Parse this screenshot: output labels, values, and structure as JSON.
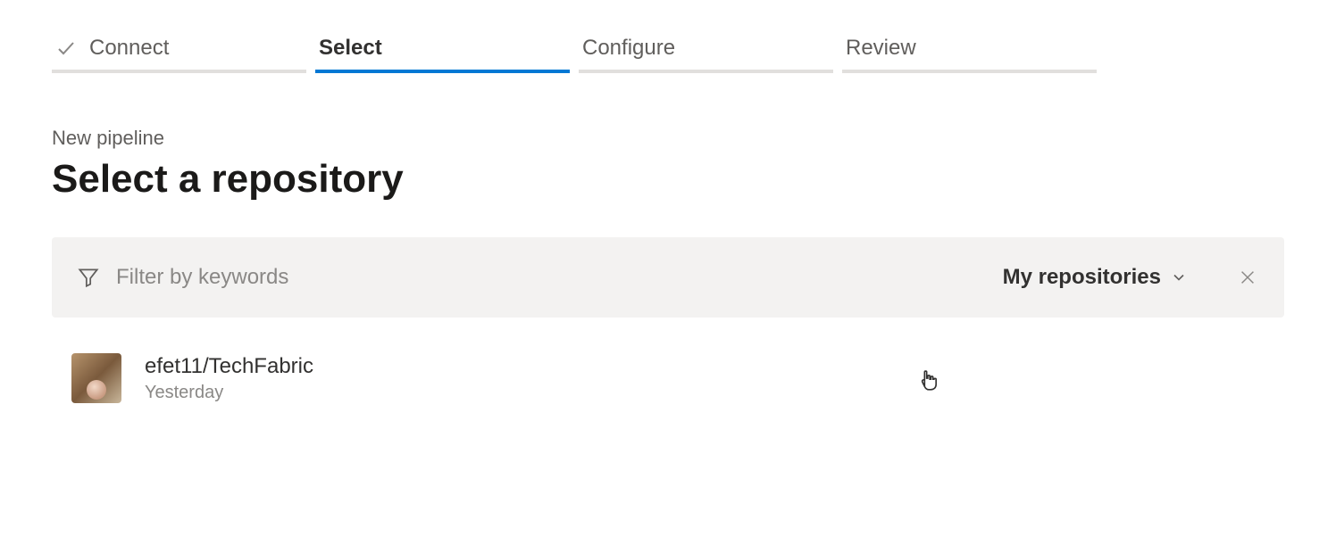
{
  "stepper": {
    "steps": [
      {
        "label": "Connect",
        "done": true,
        "active": false
      },
      {
        "label": "Select",
        "done": false,
        "active": true
      },
      {
        "label": "Configure",
        "done": false,
        "active": false
      },
      {
        "label": "Review",
        "done": false,
        "active": false
      }
    ]
  },
  "header": {
    "subtitle": "New pipeline",
    "title": "Select a repository"
  },
  "filter": {
    "placeholder": "Filter by keywords",
    "dropdown_label": "My repositories"
  },
  "repos": [
    {
      "name": "efet11/TechFabric",
      "updated": "Yesterday"
    }
  ]
}
